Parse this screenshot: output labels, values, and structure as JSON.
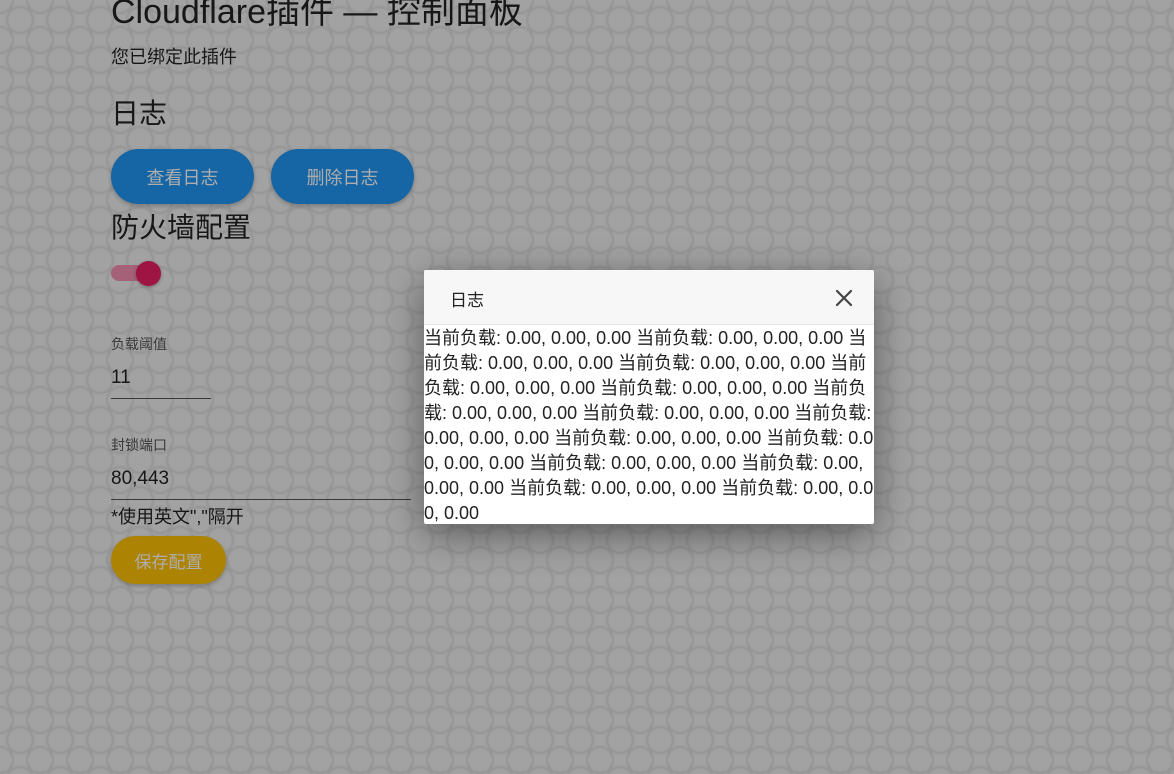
{
  "header": {
    "title": "Cloudflare插件 — 控制面板",
    "bound_status": "您已绑定此插件"
  },
  "log_section": {
    "heading": "日志",
    "view_button": "查看日志",
    "delete_button": "删除日志"
  },
  "firewall": {
    "heading": "防火墙配置",
    "enabled": true,
    "load_threshold": {
      "label": "负载阈值",
      "value": "11"
    },
    "blocked_ports": {
      "label": "封锁端口",
      "value": "80,443"
    },
    "hint": "*使用英文\",\"隔开",
    "save_button": "保存配置"
  },
  "dialog": {
    "title": "日志",
    "close_icon": "close-icon",
    "content": "当前负载: 0.00, 0.00, 0.00 当前负载: 0.00, 0.00, 0.00 当前负载: 0.00, 0.00, 0.00 当前负载: 0.00, 0.00, 0.00 当前负载: 0.00, 0.00, 0.00 当前负载: 0.00, 0.00, 0.00 当前负载: 0.00, 0.00, 0.00 当前负载: 0.00, 0.00, 0.00 当前负载: 0.00, 0.00, 0.00 当前负载: 0.00, 0.00, 0.00 当前负载: 0.00, 0.00, 0.00 当前负载: 0.00, 0.00, 0.00 当前负载: 0.00, 0.00, 0.00 当前负载: 0.00, 0.00, 0.00 当前负载: 0.00, 0.00, 0.00"
  },
  "colors": {
    "primary_button": "#2196f3",
    "save_button": "#ffc107",
    "toggle_on": "#e91e63"
  }
}
